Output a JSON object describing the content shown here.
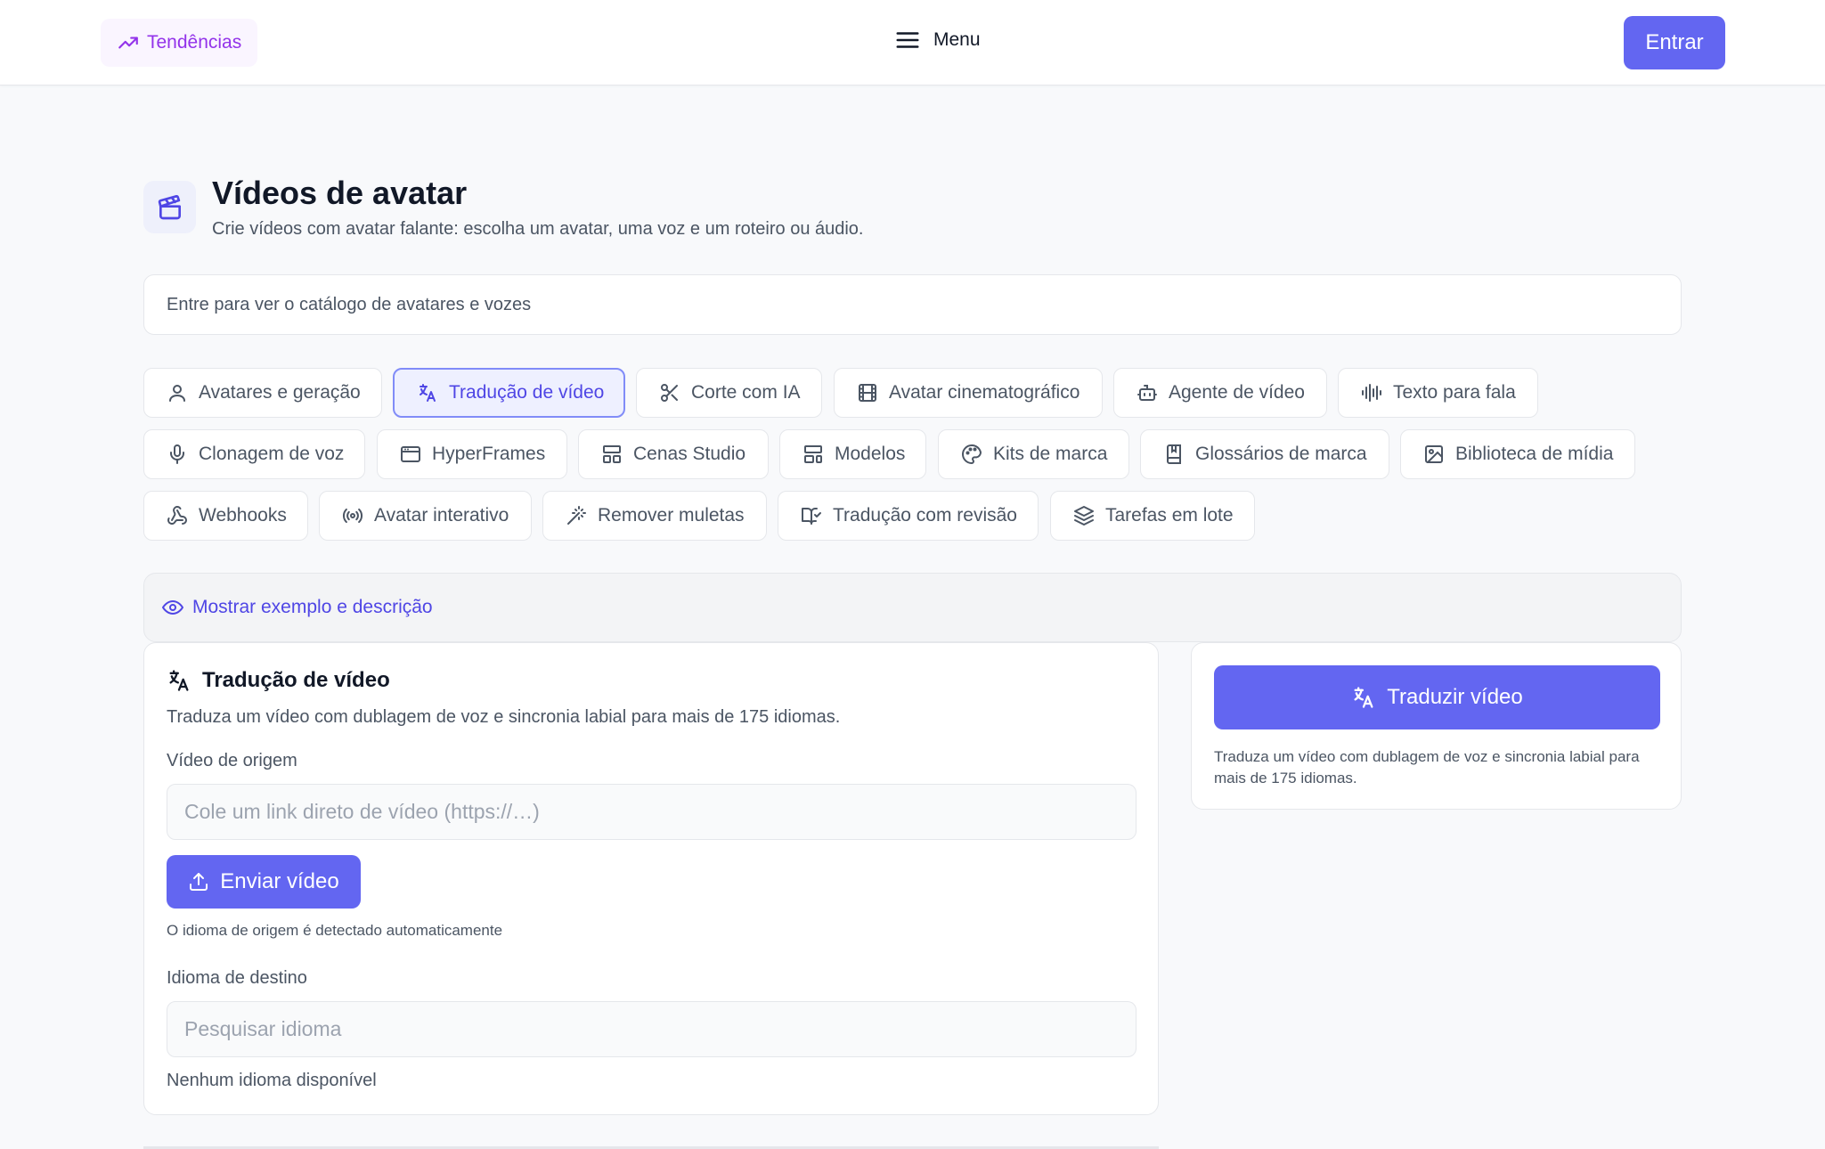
{
  "header": {
    "trending_label": "Tendências",
    "menu_label": "Menu",
    "login_label": "Entrar"
  },
  "page": {
    "title": "Vídeos de avatar",
    "subtitle": "Crie vídeos com avatar falante: escolha um avatar, uma voz e um roteiro ou áudio.",
    "catalog_notice": "Entre para ver o catálogo de avatares e vozes"
  },
  "tabs": [
    {
      "label": "Avatares e geração",
      "icon": "user-icon"
    },
    {
      "label": "Tradução de vídeo",
      "icon": "translate-icon",
      "active": true
    },
    {
      "label": "Corte com IA",
      "icon": "scissors-icon"
    },
    {
      "label": "Avatar cinematográfico",
      "icon": "film-icon"
    },
    {
      "label": "Agente de vídeo",
      "icon": "bot-icon"
    },
    {
      "label": "Texto para fala",
      "icon": "audio-wave-icon"
    },
    {
      "label": "Clonagem de voz",
      "icon": "microphone-icon"
    },
    {
      "label": "HyperFrames",
      "icon": "browser-window-icon"
    },
    {
      "label": "Cenas Studio",
      "icon": "layout-icon"
    },
    {
      "label": "Modelos",
      "icon": "template-icon"
    },
    {
      "label": "Kits de marca",
      "icon": "palette-icon"
    },
    {
      "label": "Glossários de marca",
      "icon": "book-icon"
    },
    {
      "label": "Biblioteca de mídia",
      "icon": "image-icon"
    },
    {
      "label": "Webhooks",
      "icon": "webhook-icon"
    },
    {
      "label": "Avatar interativo",
      "icon": "broadcast-icon"
    },
    {
      "label": "Remover muletas",
      "icon": "magic-wand-icon"
    },
    {
      "label": "Tradução com revisão",
      "icon": "book-check-icon"
    },
    {
      "label": "Tarefas em lote",
      "icon": "layers-icon"
    }
  ],
  "example_toggle": "Mostrar exemplo e descrição",
  "form": {
    "title": "Tradução de vídeo",
    "description": "Traduza um vídeo com dublagem de voz e sincronia labial para mais de 175 idiomas.",
    "source_label": "Vídeo de origem",
    "source_placeholder": "Cole um link direto de vídeo (https://…)",
    "source_value": "",
    "upload_label": "Enviar vídeo",
    "source_hint": "O idioma de origem é detectado automaticamente",
    "target_label": "Idioma de destino",
    "target_placeholder": "Pesquisar idioma",
    "target_value": "",
    "empty_languages": "Nenhum idioma disponível"
  },
  "side": {
    "button_label": "Traduzir vídeo",
    "description": "Traduza um vídeo com dublagem de voz e sincronia labial para mais de 175 idiomas."
  },
  "colors": {
    "accent": "#6366f1",
    "accent_text": "#4f46e5",
    "trending": "#9333ea",
    "background": "#f8f9fb"
  }
}
